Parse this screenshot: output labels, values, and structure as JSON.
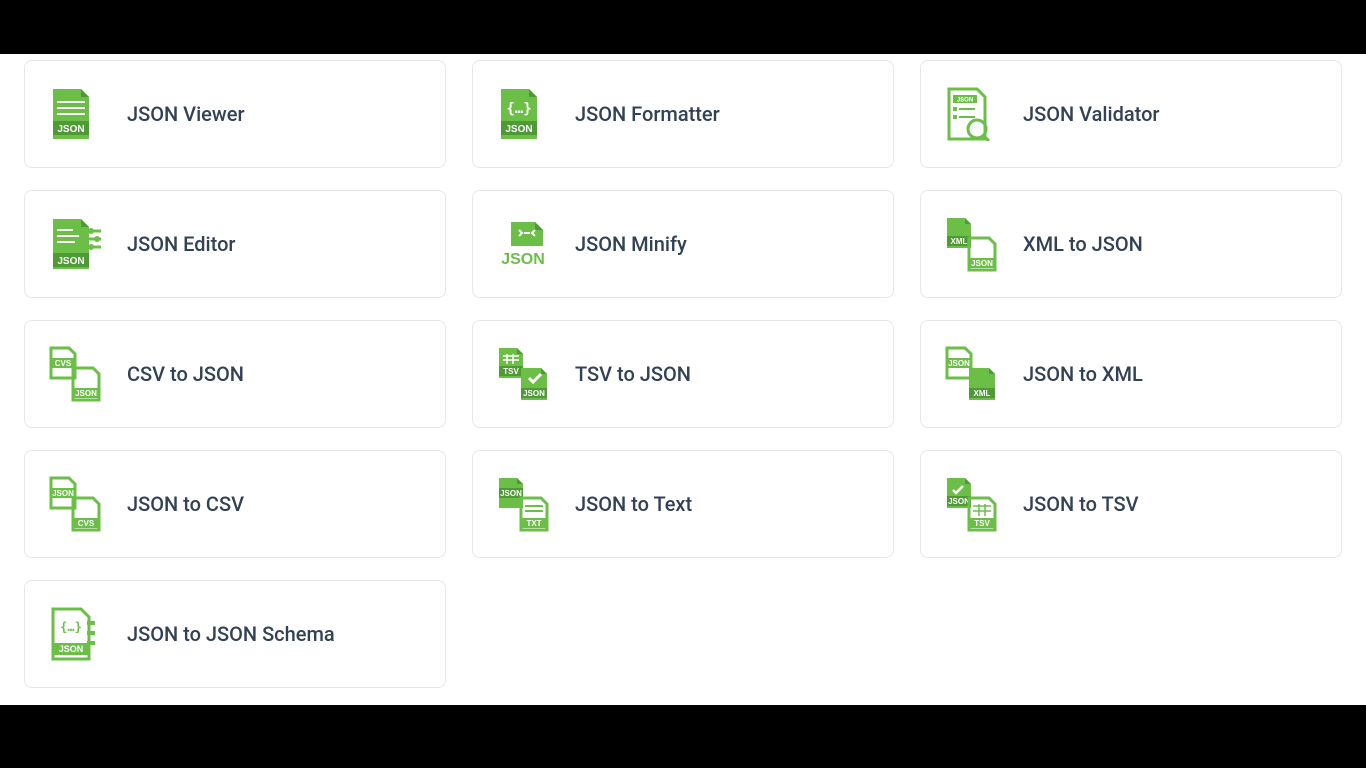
{
  "colors": {
    "accent": "#6bbf47",
    "text": "#334155"
  },
  "tools": [
    {
      "label": "JSON Viewer",
      "icon": "json-viewer-icon"
    },
    {
      "label": "JSON Formatter",
      "icon": "json-formatter-icon"
    },
    {
      "label": "JSON Validator",
      "icon": "json-validator-icon"
    },
    {
      "label": "JSON Editor",
      "icon": "json-editor-icon"
    },
    {
      "label": "JSON Minify",
      "icon": "json-minify-icon"
    },
    {
      "label": "XML to JSON",
      "icon": "xml-to-json-icon"
    },
    {
      "label": "CSV to JSON",
      "icon": "csv-to-json-icon"
    },
    {
      "label": "TSV to JSON",
      "icon": "tsv-to-json-icon"
    },
    {
      "label": "JSON to XML",
      "icon": "json-to-xml-icon"
    },
    {
      "label": "JSON to CSV",
      "icon": "json-to-csv-icon"
    },
    {
      "label": "JSON to Text",
      "icon": "json-to-text-icon"
    },
    {
      "label": "JSON to TSV",
      "icon": "json-to-tsv-icon"
    },
    {
      "label": "JSON to JSON Schema",
      "icon": "json-schema-icon"
    }
  ]
}
